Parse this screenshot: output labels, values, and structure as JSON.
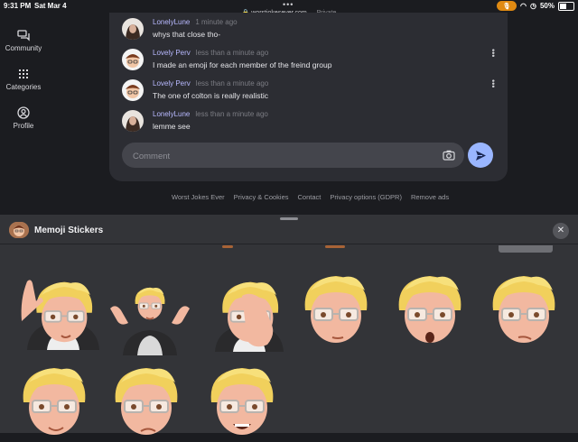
{
  "status_bar": {
    "time": "9:31 PM",
    "date": "Sat Mar 4",
    "url": "worstjokesever.com",
    "url_suffix": "— Private",
    "battery": "50%"
  },
  "sidebar": {
    "items": [
      {
        "label": "Community",
        "icon": "chat-icon"
      },
      {
        "label": "Categories",
        "icon": "grid-icon"
      },
      {
        "label": "Profile",
        "icon": "person-icon"
      }
    ]
  },
  "comments": [
    {
      "author": "LonelyLune",
      "time": "1 minute ago",
      "text": "whys that close tho-",
      "avatar": "photo"
    },
    {
      "author": "Lovely Perv",
      "time": "less than a minute ago",
      "text": "I made an emoji for each member of the freind group",
      "avatar": "memoji",
      "has_menu": true
    },
    {
      "author": "Lovely Perv",
      "time": "less than a minute ago",
      "text": "The one of colton is really realistic",
      "avatar": "memoji",
      "has_menu": true
    },
    {
      "author": "LonelyLune",
      "time": "less than a minute ago",
      "text": "lemme see",
      "avatar": "photo"
    }
  ],
  "comment_input": {
    "placeholder": "Comment",
    "value": ""
  },
  "footer_links": [
    "Worst Jokes Ever",
    "Privacy & Cookies",
    "Contact",
    "Privacy options (GDPR)",
    "Remove ads"
  ],
  "sticker_sheet": {
    "title": "Memoji Stickers",
    "stickers": [
      "waving",
      "shrugging",
      "facepalm",
      "neutral",
      "surprised",
      "smug",
      "winking",
      "frowning",
      "grinning"
    ]
  },
  "colors": {
    "accent": "#9ab6ff",
    "mic_indicator": "#e08a12",
    "background": "#1b1c20",
    "panel": "#2c2d33",
    "sheet": "#333438"
  }
}
